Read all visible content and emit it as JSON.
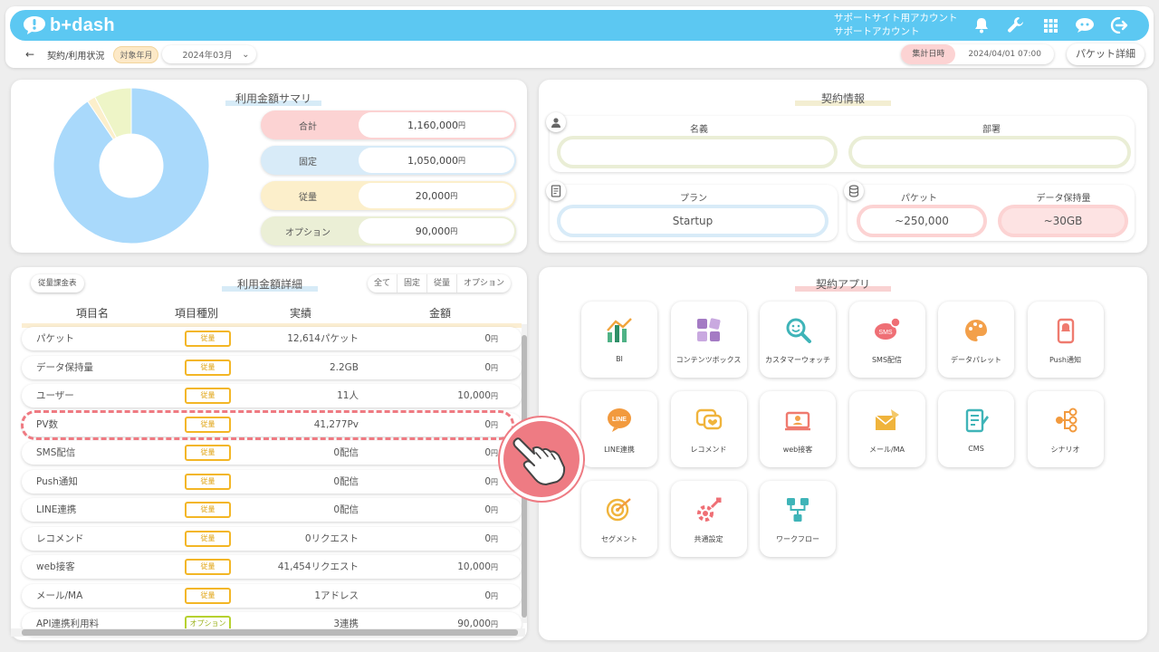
{
  "app": {
    "logo_text": "b+dash"
  },
  "header": {
    "account_line1": "サポートサイト用アカウント",
    "account_line2": "サポートアカウント",
    "icons": [
      "bell-icon",
      "wrench-icon",
      "grid-icon",
      "support-chat-icon",
      "logout-icon"
    ]
  },
  "subbar": {
    "back": "←",
    "page_title": "契約/利用状況",
    "period_label": "対象年月",
    "period_value": "2024年03月",
    "agg_label": "集計日時",
    "agg_value": "2024/04/01 07:00",
    "packet_detail_button": "パケット詳細"
  },
  "summary": {
    "title": "利用金額サマリ",
    "rows": [
      {
        "label": "合計",
        "value": "1,160,000",
        "unit": "円",
        "color": "#fcd3d3"
      },
      {
        "label": "固定",
        "value": "1,050,000",
        "unit": "円",
        "color": "#d8ebf8"
      },
      {
        "label": "従量",
        "value": "20,000",
        "unit": "円",
        "color": "#fcefcb"
      },
      {
        "label": "オプション",
        "value": "90,000",
        "unit": "円",
        "color": "#ebefd6"
      }
    ],
    "donut": {
      "fixed": 1050000,
      "metered": 20000,
      "option": 90000,
      "colors": {
        "fixed": "#a9d9fb",
        "metered": "#fcefcb",
        "option": "#eef5c7"
      }
    }
  },
  "contract": {
    "title": "契約情報",
    "name_label": "名義",
    "name_value": "",
    "dept_label": "部署",
    "dept_value": "",
    "plan_label": "プラン",
    "plan_value": "Startup",
    "packet_label": "パケット",
    "packet_value": "~250,000",
    "storage_label": "データ保持量",
    "storage_value": "~30GB"
  },
  "detail": {
    "title": "利用金額詳細",
    "rate_table_button": "従量課金表",
    "tabs": [
      "全て",
      "固定",
      "従量",
      "オプション"
    ],
    "columns": [
      "項目名",
      "項目種別",
      "実績",
      "金額"
    ],
    "rows": [
      {
        "name": "パケット",
        "type": "従量",
        "actual": "12,614パケット",
        "amount": "0",
        "unit": "円"
      },
      {
        "name": "データ保持量",
        "type": "従量",
        "actual": "2.2GB",
        "amount": "0",
        "unit": "円"
      },
      {
        "name": "ユーザー",
        "type": "従量",
        "actual": "11人",
        "amount": "10,000",
        "unit": "円"
      },
      {
        "name": "PV数",
        "type": "従量",
        "actual": "41,277Pv",
        "amount": "0",
        "unit": "円"
      },
      {
        "name": "SMS配信",
        "type": "従量",
        "actual": "0配信",
        "amount": "0",
        "unit": "円"
      },
      {
        "name": "Push通知",
        "type": "従量",
        "actual": "0配信",
        "amount": "0",
        "unit": "円"
      },
      {
        "name": "LINE連携",
        "type": "従量",
        "actual": "0配信",
        "amount": "0",
        "unit": "円"
      },
      {
        "name": "レコメンド",
        "type": "従量",
        "actual": "0リクエスト",
        "amount": "0",
        "unit": "円"
      },
      {
        "name": "web接客",
        "type": "従量",
        "actual": "41,454リクエスト",
        "amount": "10,000",
        "unit": "円"
      },
      {
        "name": "メール/MA",
        "type": "従量",
        "actual": "1アドレス",
        "amount": "0",
        "unit": "円"
      },
      {
        "name": "API連携利用料",
        "type": "オプション",
        "actual": "3連携",
        "amount": "90,000",
        "unit": "円"
      }
    ]
  },
  "apps": {
    "title": "契約アプリ",
    "items": [
      {
        "label": "BI",
        "icon": "bi-chart-icon"
      },
      {
        "label": "コンテンツボックス",
        "icon": "content-box-icon"
      },
      {
        "label": "カスタマーウォッチ",
        "icon": "customer-watch-icon"
      },
      {
        "label": "SMS配信",
        "icon": "sms-icon"
      },
      {
        "label": "データパレット",
        "icon": "data-palette-icon"
      },
      {
        "label": "Push通知",
        "icon": "push-notification-icon"
      },
      {
        "label": "LINE連携",
        "icon": "line-icon"
      },
      {
        "label": "レコメンド",
        "icon": "recommend-icon"
      },
      {
        "label": "web接客",
        "icon": "web-service-icon"
      },
      {
        "label": "メール/MA",
        "icon": "mail-icon"
      },
      {
        "label": "CMS",
        "icon": "cms-icon"
      },
      {
        "label": "シナリオ",
        "icon": "scenario-icon"
      },
      {
        "label": "セグメント",
        "icon": "segment-icon"
      },
      {
        "label": "共通設定",
        "icon": "common-settings-icon"
      },
      {
        "label": "ワークフロー",
        "icon": "workflow-icon"
      }
    ]
  }
}
